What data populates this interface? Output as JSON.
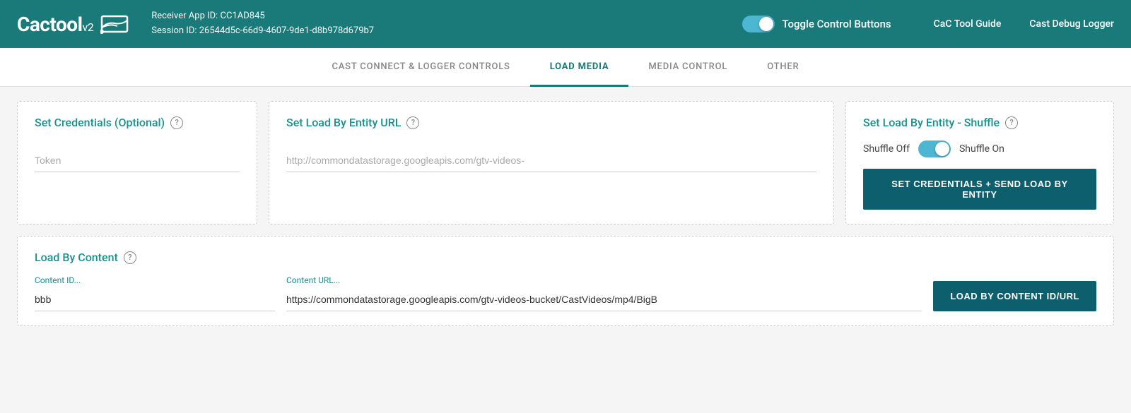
{
  "header": {
    "logo_text": "Cactool",
    "logo_version": "v2",
    "receiver_app_label": "Receiver App ID:",
    "receiver_app_id": "CC1AD845",
    "session_label": "Session ID:",
    "session_id": "26544d5c-66d9-4607-9de1-d8b978d679b7",
    "toggle_label": "Toggle Control Buttons",
    "nav_guide": "CaC Tool Guide",
    "nav_logger": "Cast Debug Logger"
  },
  "tabs": [
    {
      "id": "tab-cast",
      "label": "CAST CONNECT & LOGGER CONTROLS",
      "active": false
    },
    {
      "id": "tab-load-media",
      "label": "LOAD MEDIA",
      "active": true
    },
    {
      "id": "tab-media-control",
      "label": "MEDIA CONTROL",
      "active": false
    },
    {
      "id": "tab-other",
      "label": "OTHER",
      "active": false
    }
  ],
  "sections": {
    "credentials": {
      "title": "Set Credentials (Optional)",
      "placeholder": "Token"
    },
    "entity_url": {
      "title": "Set Load By Entity URL",
      "placeholder": "http://commondatastorage.googleapis.com/gtv-videos-"
    },
    "shuffle": {
      "title": "Set Load By Entity - Shuffle",
      "shuffle_off": "Shuffle Off",
      "shuffle_on": "Shuffle On",
      "button_label": "SET CREDENTIALS + SEND LOAD BY ENTITY"
    },
    "load_by_content": {
      "title": "Load By Content",
      "content_id_label": "Content ID...",
      "content_id_value": "bbb",
      "content_url_label": "Content URL...",
      "content_url_value": "https://commondatastorage.googleapis.com/gtv-videos-bucket/CastVideos/mp4/BigB",
      "button_label": "LOAD BY CONTENT ID/URL"
    }
  }
}
